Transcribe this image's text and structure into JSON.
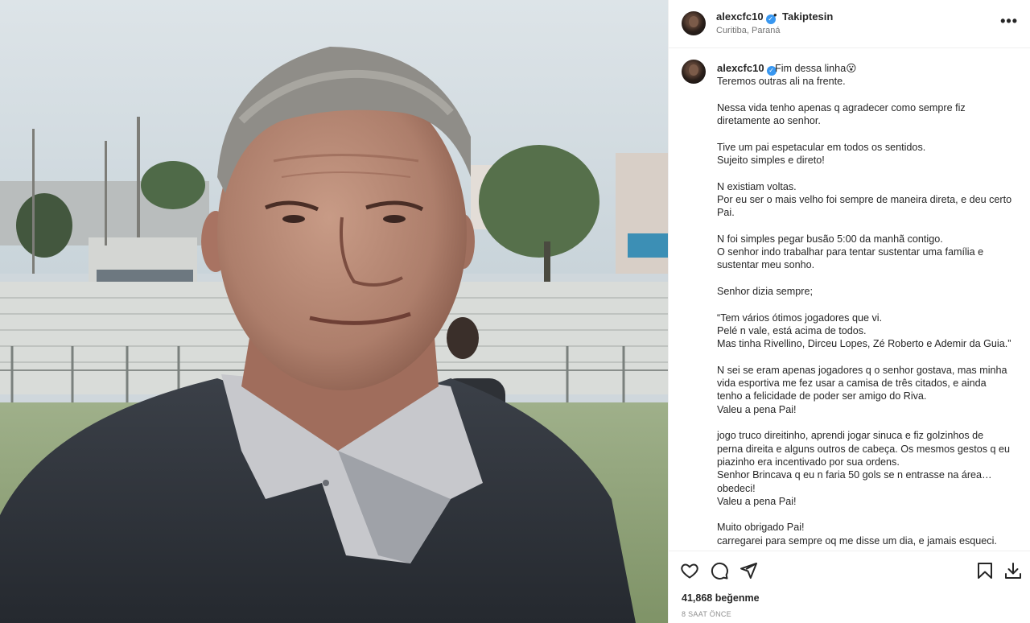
{
  "post": {
    "header": {
      "username": "alexcfc10",
      "verified": true,
      "separator": "•",
      "follow_label": "Takiptesin",
      "location": "Curitiba, Paraná",
      "more_icon": "more-horizontal-icon"
    },
    "caption": {
      "username": "alexcfc10",
      "first_line": "Fim dessa linha😮",
      "lines": [
        "Teremos outras ali na frente.",
        "",
        "Nessa vida tenho apenas q agradecer como sempre fiz",
        "diretamente ao senhor.",
        "",
        "Tive um pai espetacular em todos os sentidos.",
        "Sujeito simples e direto!",
        "",
        "N existiam voltas.",
        "Por eu ser o mais velho foi sempre de maneira direta, e deu certo",
        "Pai.",
        "",
        "N foi simples pegar busão 5:00 da manhã contigo.",
        "O senhor indo trabalhar para tentar sustentar uma família e",
        "sustentar meu sonho.",
        "",
        "Senhor dizia sempre;",
        "",
        "“Tem vários ótimos jogadores que vi.",
        "Pelé n vale, está acima de todos.",
        "Mas tinha Rivellino, Dirceu Lopes, Zé Roberto e Ademir da Guia.”",
        "",
        "N sei se eram apenas jogadores q o senhor gostava, mas minha",
        "vida esportiva me fez usar a camisa de três citados, e ainda",
        "tenho a felicidade de poder ser amigo do Riva.",
        "Valeu a pena Pai!",
        "",
        "jogo truco direitinho, aprendi jogar sinuca e fiz golzinhos de",
        "perna direita e alguns outros de cabeça. Os mesmos gestos q eu",
        "piazinho era incentivado por sua ordens.",
        "Senhor Brincava q eu n faria 50 gols se n entrasse na área…",
        "obedeci!",
        "Valeu a pena Pai!",
        "",
        "Muito obrigado Pai!",
        "carregarei para sempre oq me disse um dia, e jamais esqueci."
      ]
    },
    "actions": {
      "like_icon": "heart-icon",
      "comment_icon": "comment-icon",
      "share_icon": "share-icon",
      "save_icon": "bookmark-icon",
      "download_icon": "download-icon"
    },
    "likes_text": "41,868 beğenme",
    "timestamp": "8 SAAT ÖNCE"
  },
  "colors": {
    "verified_badge": "#3897f0",
    "text_primary": "#262626",
    "text_secondary": "#737373",
    "divider": "#efefef"
  }
}
